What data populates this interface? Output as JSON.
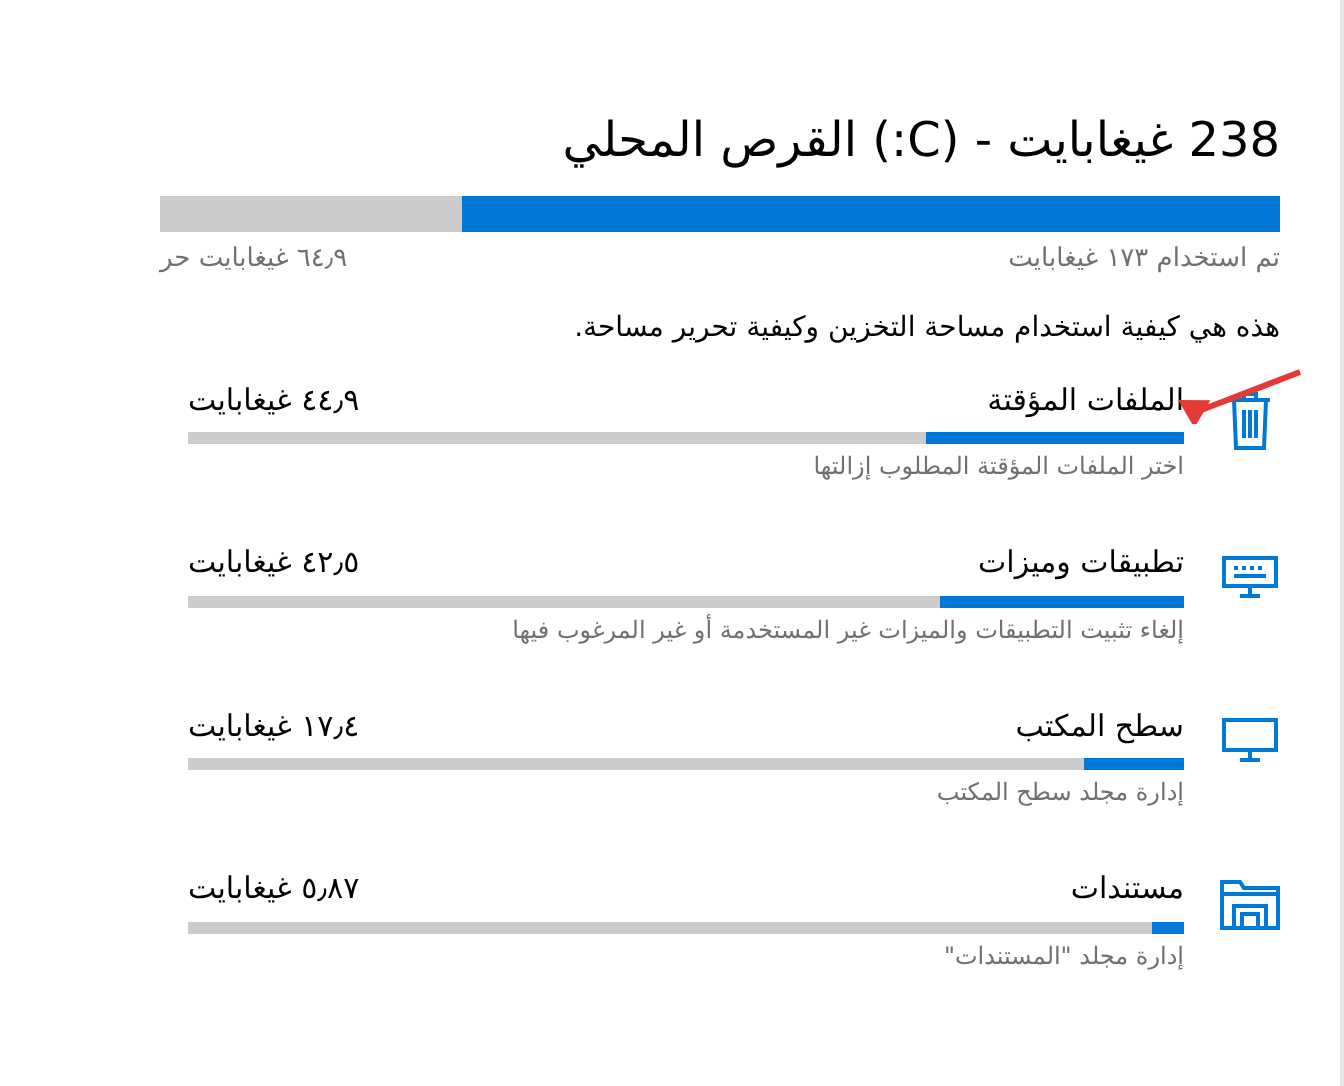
{
  "title": "238 غيغابايت - (C:) القرص المحلي",
  "drive": {
    "level": 0.73,
    "used": "تم استخدام ١٧٣ غيغابايت",
    "free": "٦٤٫٩ غيغابايت حر"
  },
  "description": "هذه هي كيفية استخدام مساحة التخزين وكيفية تحرير مساحة.",
  "categories": [
    {
      "kind": "trash",
      "name": "الملفات المؤقتة",
      "size": "٤٤٫٩ غيغابايت",
      "level": 0.26,
      "hint": "اختر الملفات المؤقتة المطلوب إزالتها"
    },
    {
      "kind": "apps",
      "name": "تطبيقات وميزات",
      "size": "٤٢٫٥ غيغابايت",
      "level": 0.245,
      "hint": "إلغاء تثبيت التطبيقات والميزات غير المستخدمة أو غير المرغوب فيها"
    },
    {
      "kind": "desktop",
      "name": "سطح المكتب",
      "size": "١٧٫٤ غيغابايت",
      "level": 0.1,
      "hint": "إدارة مجلد سطح المكتب"
    },
    {
      "kind": "documents",
      "name": "مستندات",
      "size": "٥٫٨٧ غيغابايت",
      "level": 0.033,
      "hint": "إدارة مجلد \"المستندات\""
    }
  ]
}
